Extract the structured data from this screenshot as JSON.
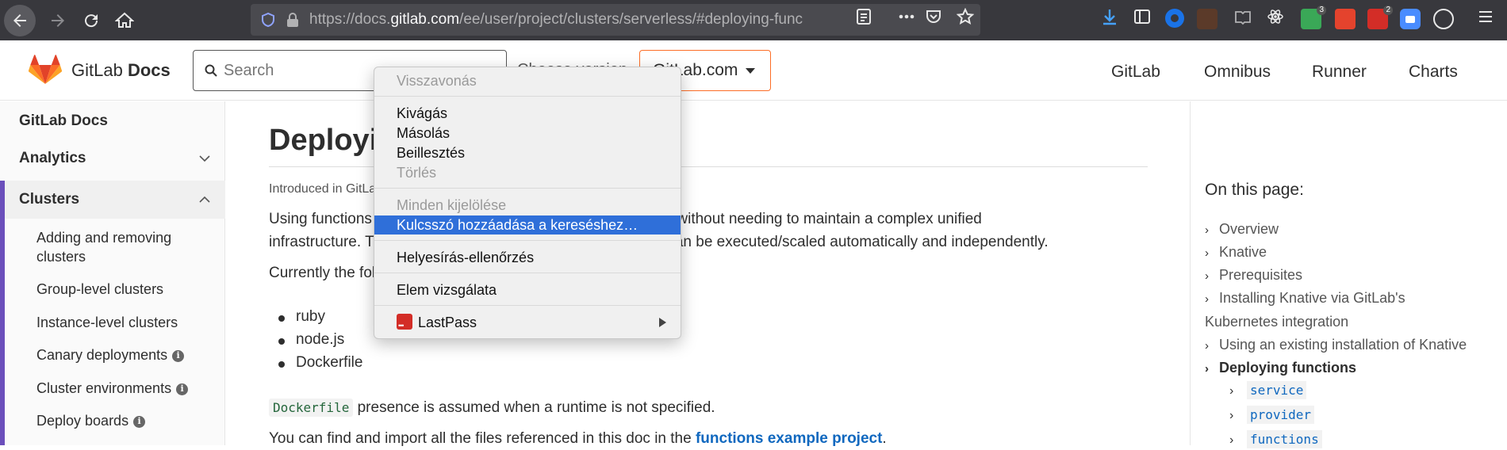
{
  "browser": {
    "url_prefix": "https://docs.",
    "url_domain": "gitlab.com",
    "url_path": "/ee/user/project/clusters/serverless/#deploying-func",
    "icons": [
      "back-icon",
      "forward-icon",
      "reload-icon",
      "home-icon",
      "shield-icon",
      "lock-icon",
      "reader-view-icon",
      "more-icon",
      "pocket-icon",
      "bookmark-star-icon",
      "download-icon",
      "sidebar-icon",
      "menu-icon"
    ],
    "badges": {
      "ext_green": "3",
      "ext_red": "2"
    }
  },
  "header": {
    "brand_name": "GitLab",
    "brand_suffix": "Docs",
    "search_placeholder": "Search",
    "version_label": "Choose version",
    "version_value": "GitLab.com",
    "nav": [
      "GitLab",
      "Omnibus",
      "Runner",
      "Charts"
    ],
    "accent": "#fc6d26"
  },
  "sidebar": {
    "top_link": "GitLab Docs",
    "sections": [
      {
        "label": "Analytics",
        "expanded": false
      },
      {
        "label": "Clusters",
        "expanded": true
      }
    ],
    "items": [
      {
        "label": "Adding and removing clusters",
        "info": false
      },
      {
        "label": "Group-level clusters",
        "info": false
      },
      {
        "label": "Instance-level clusters",
        "info": false
      },
      {
        "label": "Canary deployments",
        "info": true
      },
      {
        "label": "Cluster environments",
        "info": true
      },
      {
        "label": "Deploy boards",
        "info": true
      }
    ],
    "accent": "#6b4fbb"
  },
  "content": {
    "title": "Deploying functions",
    "introduced": "Introduced in GitLab 11.6.",
    "para1_line1": "Using functions is useful for dealing with independent events without needing to maintain a complex unified",
    "para1_line2": "infrastructure. This allows you to focus on a single task that can be executed/scaled automatically and independently.",
    "para2": "Currently the following runtimes are offered:",
    "runtimes": [
      "ruby",
      "node.js",
      "Dockerfile"
    ],
    "dockerfile_code": "Dockerfile",
    "dockerfile_text": " presence is assumed when a runtime is not specified.",
    "find_text": "You can find and import all the files referenced in this doc in the ",
    "find_link": "functions example project",
    "find_end": "."
  },
  "toc": {
    "title": "On this page:",
    "items": [
      {
        "label": "Overview"
      },
      {
        "label": "Knative"
      },
      {
        "label": "Prerequisites"
      },
      {
        "label_line1": "Installing Knative via GitLab's",
        "label_line2": "Kubernetes integration"
      },
      {
        "label": "Using an existing installation of Knative"
      },
      {
        "label": "Deploying functions",
        "active": true
      }
    ],
    "sub_items": [
      "service",
      "provider",
      "functions"
    ]
  },
  "context_menu": {
    "items": [
      {
        "label": "Visszavonás",
        "disabled": true
      },
      {
        "label": "Kivágás"
      },
      {
        "label": "Másolás"
      },
      {
        "label": "Beillesztés"
      },
      {
        "label": "Törlés",
        "disabled": true
      },
      {
        "label": "Minden kijelölése",
        "disabled": true
      },
      {
        "label": "Kulcsszó hozzáadása a kereséshez…",
        "highlighted": true
      },
      {
        "label": "Helyesírás-ellenőrzés"
      },
      {
        "label": "Elem vizsgálata"
      },
      {
        "label": "LastPass",
        "submenu": true
      }
    ]
  }
}
